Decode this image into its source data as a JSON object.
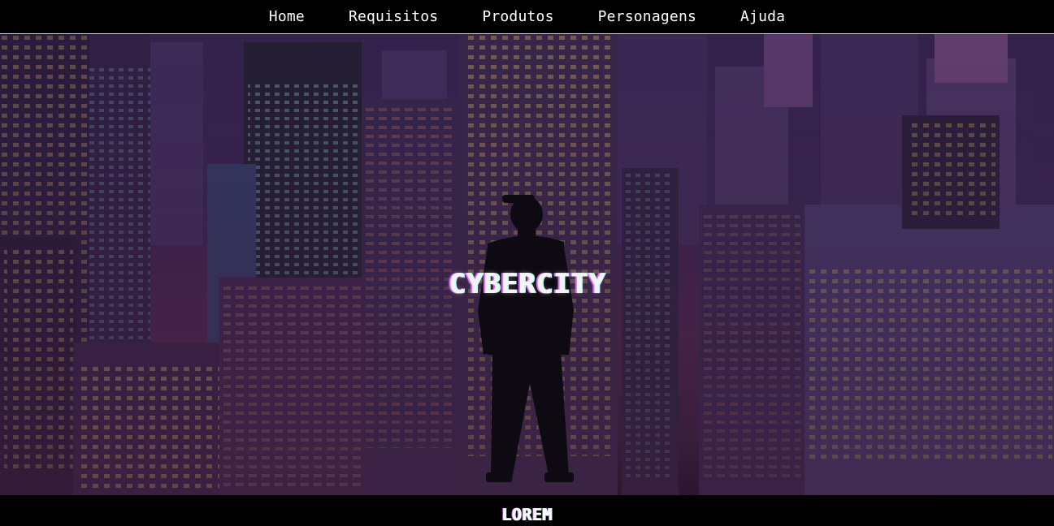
{
  "nav": {
    "items": [
      {
        "label": "Home"
      },
      {
        "label": "Requisitos"
      },
      {
        "label": "Produtos"
      },
      {
        "label": "Personagens"
      },
      {
        "label": "Ajuda"
      }
    ]
  },
  "hero": {
    "title": "CYBERCITY",
    "background": "night-city-skyline-with-silhouette-image"
  },
  "section": {
    "heading": "LOREM"
  },
  "colors": {
    "nav_bg": "#000000",
    "text": "#ffffff",
    "sky_purple": "#3b2450",
    "window_light": "#e8c46a"
  }
}
